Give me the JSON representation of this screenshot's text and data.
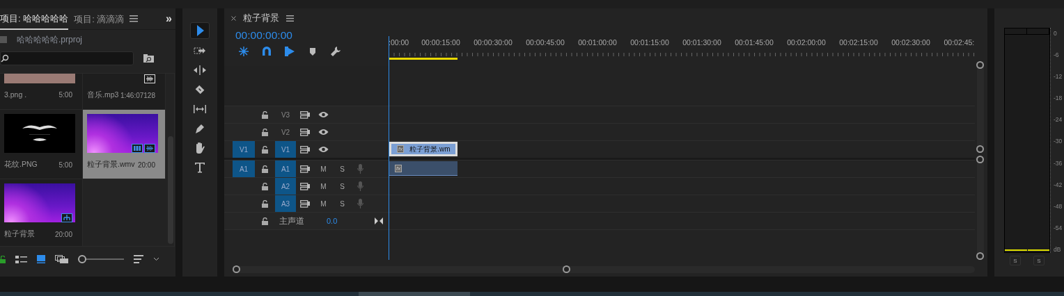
{
  "project_panel": {
    "tabs": [
      {
        "label": "项目: 哈哈哈哈哈",
        "selected": true
      },
      {
        "label": "项目: 滴滴滴",
        "selected": false
      }
    ],
    "overflow": "»",
    "project_file": "哈哈哈哈哈.prproj",
    "items": [
      {
        "name": "3.png  .",
        "duration": "5:00",
        "selected": false,
        "kind": "photo"
      },
      {
        "name": "音乐.mp3",
        "duration": "1:46:07128",
        "selected": false,
        "kind": "audio"
      },
      {
        "name": "花纹.PNG",
        "duration": "5:00",
        "selected": false,
        "kind": "graphic"
      },
      {
        "name": "粒子背景.wmv",
        "duration": "20:00",
        "selected": true,
        "kind": "clip"
      },
      {
        "name": "粒子背景",
        "duration": "20:00",
        "selected": false,
        "kind": "sequence"
      }
    ],
    "views": [
      {
        "kind": "list",
        "selected": false
      },
      {
        "kind": "icon",
        "selected": true
      },
      {
        "kind": "freeform",
        "selected": false
      }
    ],
    "zoom": {
      "level": 0
    }
  },
  "tools": [
    {
      "kind": "selection",
      "selected": true
    },
    {
      "kind": "track-select",
      "selected": false
    },
    {
      "kind": "ripple",
      "selected": false
    },
    {
      "kind": "razor",
      "selected": false
    },
    {
      "kind": "slip",
      "selected": false
    },
    {
      "kind": "pen",
      "selected": false
    },
    {
      "kind": "hand",
      "selected": false
    },
    {
      "kind": "type",
      "selected": false
    }
  ],
  "timeline": {
    "title": "粒子背景",
    "timecode": "00:00:00:00",
    "tools": [
      {
        "kind": "nest",
        "on": true
      },
      {
        "kind": "snap",
        "on": true
      },
      {
        "kind": "linked",
        "on": true
      },
      {
        "kind": "marker",
        "on": false
      },
      {
        "kind": "settings",
        "on": false
      }
    ],
    "ruler_labels": [
      ":00:00",
      "00:00:15:00",
      "00:00:30:00",
      "00:00:45:00",
      "00:01:00:00",
      "00:01:15:00",
      "00:01:30:00",
      "00:01:45:00",
      "00:02:00:00",
      "00:02:15:00",
      "00:02:30:00",
      "00:02:45:"
    ],
    "tracks": [
      {
        "kind": "video",
        "name": "V3",
        "targeted": false
      },
      {
        "kind": "video",
        "name": "V2",
        "targeted": false
      },
      {
        "kind": "video",
        "name": "V1",
        "targeted": true,
        "source": "V1",
        "clip": {
          "label": "粒子背景.wm",
          "effect": "fx"
        }
      },
      {
        "kind": "audio",
        "name": "A1",
        "targeted": true,
        "source": "A1",
        "mute": "M",
        "solo": "S",
        "clip": {
          "effect": "fx"
        }
      },
      {
        "kind": "audio",
        "name": "A2",
        "targeted": true,
        "mute": "M",
        "solo": "S"
      },
      {
        "kind": "audio",
        "name": "A3",
        "targeted": true,
        "mute": "M",
        "solo": "S"
      },
      {
        "kind": "master",
        "name": "主声道",
        "volume": "0.0"
      }
    ]
  },
  "audio_meter": {
    "scale": [
      "0",
      "-6",
      "-12",
      "-18",
      "-24",
      "-30",
      "-36",
      "-42",
      "-48",
      "-54",
      "dB"
    ],
    "solo": [
      "S",
      "S"
    ]
  }
}
